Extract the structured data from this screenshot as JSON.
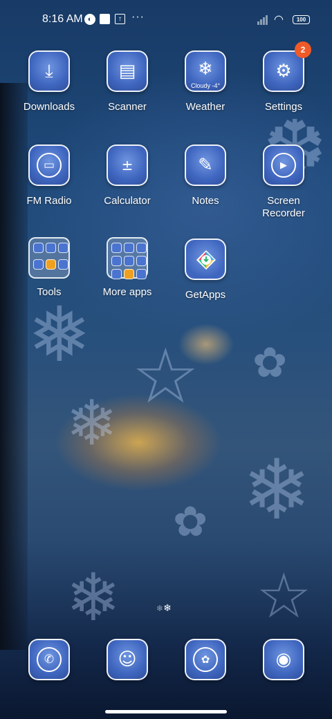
{
  "status_bar": {
    "time": "8:16 AM",
    "notif_icons": [
      "user-circle-icon",
      "square-icon",
      "upload-icon"
    ],
    "more_glyph": "···",
    "battery": "100"
  },
  "apps": [
    {
      "id": "downloads",
      "label": "Downloads",
      "icon": "download-icon",
      "glyph": "⤓"
    },
    {
      "id": "scanner",
      "label": "Scanner",
      "icon": "scanner-icon",
      "glyph": "▤"
    },
    {
      "id": "weather",
      "label": "Weather",
      "icon": "snowflake-icon",
      "glyph": "❄",
      "subtext": "Cloudy -4°"
    },
    {
      "id": "settings",
      "label": "Settings",
      "icon": "gear-icon",
      "glyph": "⚙",
      "badge": "2"
    },
    {
      "id": "fm-radio",
      "label": "FM Radio",
      "icon": "radio-icon",
      "glyph": "📻"
    },
    {
      "id": "calculator",
      "label": "Calculator",
      "icon": "calculator-icon",
      "glyph": "±"
    },
    {
      "id": "notes",
      "label": "Notes",
      "icon": "pencil-icon",
      "glyph": "✎"
    },
    {
      "id": "screen-recorder",
      "label": "Screen Recorder",
      "label_line1": "Screen",
      "label_line2": "Recorder",
      "icon": "video-camera-icon",
      "glyph": "▶"
    },
    {
      "id": "tools",
      "label": "Tools",
      "icon": "folder-icon"
    },
    {
      "id": "more-apps",
      "label": "More apps",
      "icon": "folder-icon"
    },
    {
      "id": "getapps",
      "label": "GetApps",
      "icon": "getapps-icon"
    }
  ],
  "dock": [
    {
      "id": "phone",
      "icon": "phone-icon",
      "glyph": "✆"
    },
    {
      "id": "contacts",
      "icon": "contacts-icon",
      "glyph": "☺"
    },
    {
      "id": "messages",
      "icon": "chat-bubble-icon",
      "glyph": "✉"
    },
    {
      "id": "camera",
      "icon": "camera-icon",
      "glyph": "◉"
    }
  ],
  "colors": {
    "icon_bg": "#4a6fc6",
    "badge": "#f05a28",
    "bg_top": "#183a66",
    "window_glow": "#ffbe46"
  }
}
